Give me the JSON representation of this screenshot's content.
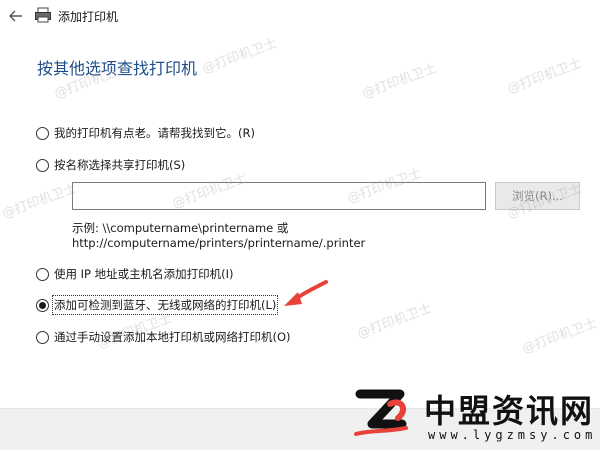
{
  "window": {
    "title": "添加打印机"
  },
  "heading": "按其他选项查找打印机",
  "options": [
    {
      "label": "我的打印机有点老。请帮我找到它。(R)",
      "checked": false
    },
    {
      "label": "按名称选择共享打印机(S)",
      "checked": false
    },
    {
      "label": "使用 IP 地址或主机名添加打印机(I)",
      "checked": false
    },
    {
      "label": "添加可检测到蓝牙、无线或网络的打印机(L)",
      "checked": true
    },
    {
      "label": "通过手动设置添加本地打印机或网络打印机(O)",
      "checked": false
    }
  ],
  "share_input": {
    "value": "",
    "browse_label": "浏览(R)..."
  },
  "example": {
    "line1": "示例: \\\\computername\\printername 或",
    "line2": "http://computername/printers/printername/.printer"
  },
  "watermark": "@打印机卫士",
  "logo": {
    "name": "中盟资讯网",
    "url": "www.lygzmsy.com"
  },
  "colors": {
    "heading": "#1e4e8c",
    "arrow": "#e8413a",
    "footer": "#f0f0f0"
  },
  "icons": [
    "back-arrow-icon",
    "printer-icon",
    "red-arrow-icon",
    "logo-mark-icon"
  ]
}
